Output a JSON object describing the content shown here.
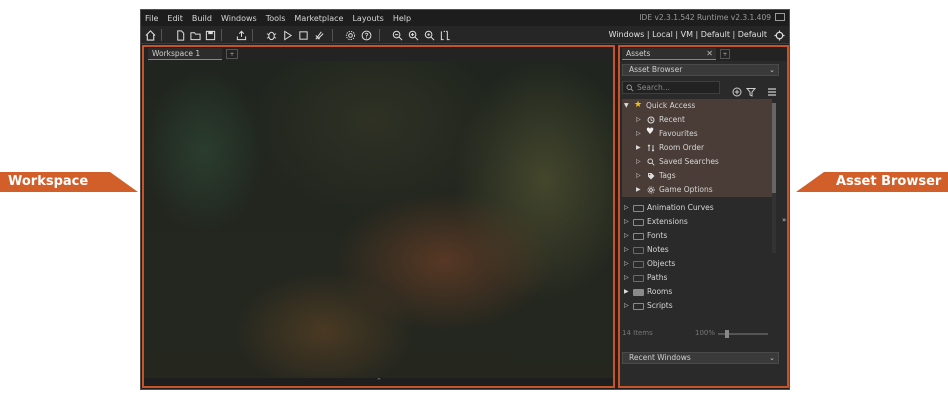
{
  "menubar": {
    "items": [
      "File",
      "Edit",
      "Build",
      "Windows",
      "Tools",
      "Marketplace",
      "Layouts",
      "Help"
    ],
    "version": "IDE v2.3.1.542  Runtime v2.3.1.409"
  },
  "toolbar": {
    "icons": [
      "home-icon",
      "new-file-icon",
      "open-folder-icon",
      "save-icon",
      "export-icon",
      "debug-icon",
      "play-icon",
      "stop-icon",
      "clean-icon",
      "settings-icon",
      "help-icon",
      "zoom-out-icon",
      "zoom-in-icon",
      "zoom-reset-icon",
      "grid-icon",
      "target-icon"
    ],
    "target": "Windows | Local | VM | Default | Default"
  },
  "workspace": {
    "tab_label": "Workspace 1"
  },
  "assets": {
    "tab_label": "Assets",
    "browser_dropdown": "Asset Browser",
    "search_placeholder": "Search...",
    "quick_access": {
      "label": "Quick Access",
      "items": [
        "Recent",
        "Favourites",
        "Room Order",
        "Saved Searches",
        "Tags",
        "Game Options"
      ]
    },
    "folders": [
      "Animation Curves",
      "Extensions",
      "Fonts",
      "Notes",
      "Objects",
      "Paths",
      "Rooms",
      "Scripts"
    ],
    "status": {
      "count": "14 Items",
      "zoom": "100%"
    },
    "recent_windows": "Recent Windows"
  },
  "callouts": {
    "left": "Workspace",
    "right": "Asset Browser"
  },
  "colors": {
    "accent": "#d25f29",
    "panel_border": "#c6532a",
    "tab_underline": "#3fb07a",
    "quick_access_bg": "#4a3d37"
  }
}
